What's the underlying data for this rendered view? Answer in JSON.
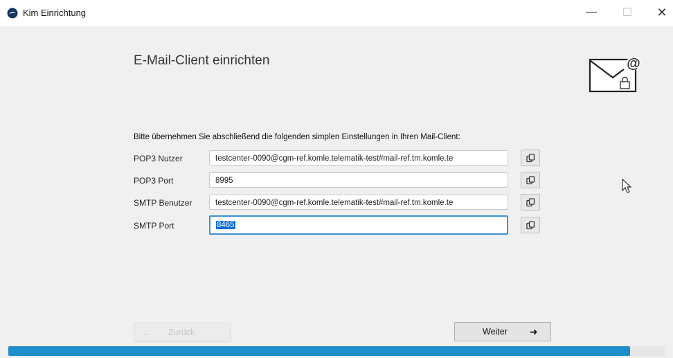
{
  "window": {
    "title": "Kim Einrichtung",
    "minimize": "—",
    "maximize": "☐",
    "close": "✕"
  },
  "page": {
    "heading": "E-Mail-Client einrichten",
    "instruction": "Bitte übernehmen Sie abschließend die folgenden simplen Einstellungen in Ihren Mail-Client:"
  },
  "settings": [
    {
      "label": "POP3 Nutzer",
      "value": "testcenter-0090@cgm-ref.komle.telematik-test#mail-ref.tm.komle.te"
    },
    {
      "label": "POP3 Port",
      "value": "8995"
    },
    {
      "label": "SMTP Benutzer",
      "value": "testcenter-0090@cgm-ref.komle.telematik-test#mail-ref.tm.komle.te"
    },
    {
      "label": "SMTP Port",
      "value": "8465"
    }
  ],
  "navigation": {
    "back_label": "Zurück",
    "back_arrow": "←",
    "next_label": "Weiter",
    "next_arrow": "➜"
  },
  "progress": {
    "fraction": 0.947
  },
  "icons": {
    "app": "kim-logo-icon",
    "mail": "mail-lock-icon",
    "copy": "copy-icon",
    "cursor": "mouse-pointer-icon"
  },
  "colors": {
    "accent": "#1e8dc8",
    "focus": "#3c93d4",
    "selection": "#0a6ed6"
  }
}
